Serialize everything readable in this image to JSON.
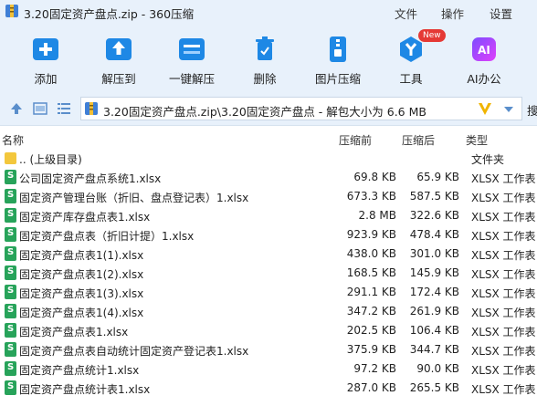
{
  "window": {
    "title": "3.20固定资产盘点.zip - 360压缩",
    "menu": [
      "文件",
      "操作",
      "设置"
    ]
  },
  "toolbar": {
    "items": [
      {
        "label": "添加",
        "icon": "add-icon"
      },
      {
        "label": "解压到",
        "icon": "extract-to-icon"
      },
      {
        "label": "一键解压",
        "icon": "one-click-extract-icon"
      },
      {
        "label": "删除",
        "icon": "delete-icon"
      },
      {
        "label": "图片压缩",
        "icon": "image-compress-icon"
      },
      {
        "label": "工具",
        "icon": "tools-icon",
        "badge": "New"
      },
      {
        "label": "AI办公",
        "icon": "ai-office-icon"
      }
    ]
  },
  "address": {
    "path": "3.20固定资产盘点.zip\\3.20固定资产盘点 - 解包大小为 6.6 MB",
    "search_partial": "搜"
  },
  "columns": {
    "name": "名称",
    "size": "压缩前",
    "compressed": "压缩后",
    "type": "类型"
  },
  "parent_row": {
    "name": ".. (上级目录)",
    "type": "文件夹"
  },
  "files": [
    {
      "name": "公司固定资产盘点系统1.xlsx",
      "size": "69.8 KB",
      "compressed": "65.9 KB",
      "type": "XLSX 工作表"
    },
    {
      "name": "固定资产管理台账（折旧、盘点登记表）1.xlsx",
      "size": "673.3 KB",
      "compressed": "587.5 KB",
      "type": "XLSX 工作表"
    },
    {
      "name": "固定资产库存盘点表1.xlsx",
      "size": "2.8 MB",
      "compressed": "322.6 KB",
      "type": "XLSX 工作表"
    },
    {
      "name": "固定资产盘点表（折旧计提）1.xlsx",
      "size": "923.9 KB",
      "compressed": "478.4 KB",
      "type": "XLSX 工作表"
    },
    {
      "name": "固定资产盘点表1(1).xlsx",
      "size": "438.0 KB",
      "compressed": "301.0 KB",
      "type": "XLSX 工作表"
    },
    {
      "name": "固定资产盘点表1(2).xlsx",
      "size": "168.5 KB",
      "compressed": "145.9 KB",
      "type": "XLSX 工作表"
    },
    {
      "name": "固定资产盘点表1(3).xlsx",
      "size": "291.1 KB",
      "compressed": "172.4 KB",
      "type": "XLSX 工作表"
    },
    {
      "name": "固定资产盘点表1(4).xlsx",
      "size": "347.2 KB",
      "compressed": "261.9 KB",
      "type": "XLSX 工作表"
    },
    {
      "name": "固定资产盘点表1.xlsx",
      "size": "202.5 KB",
      "compressed": "106.4 KB",
      "type": "XLSX 工作表"
    },
    {
      "name": "固定资产盘点表自动统计固定资产登记表1.xlsx",
      "size": "375.9 KB",
      "compressed": "344.7 KB",
      "type": "XLSX 工作表"
    },
    {
      "name": "固定资产盘点统计1.xlsx",
      "size": "97.2 KB",
      "compressed": "90.0 KB",
      "type": "XLSX 工作表"
    },
    {
      "name": "固定资产盘点统计表1.xlsx",
      "size": "287.0 KB",
      "compressed": "265.5 KB",
      "type": "XLSX 工作表"
    }
  ],
  "colors": {
    "chrome_bg": "#e8f1fb",
    "icon_blue": "#1e88e5",
    "excel_green": "#27a35a",
    "folder_yellow": "#f3c73c",
    "badge_red": "#e53935"
  }
}
